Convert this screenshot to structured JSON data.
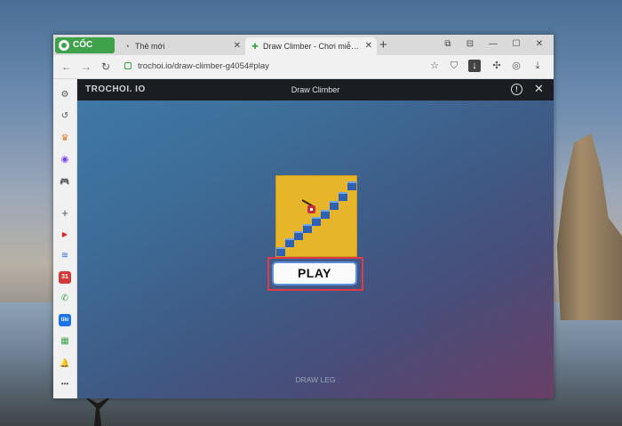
{
  "browser": {
    "brand": "CỐC CỐC",
    "tabs": [
      {
        "label": "Thẻ mới",
        "icon": "coccoc-icon",
        "active": false
      },
      {
        "label": "Draw Climber - Chơi miễn phí",
        "icon": "gamepad-icon",
        "active": true
      }
    ],
    "new_tab": "+",
    "url": "trochoi.io/draw-climber-g4054#play",
    "window_controls": {
      "minimize": "—",
      "maximize": "☐",
      "close": "✕"
    }
  },
  "sidebar": {
    "items": [
      {
        "name": "settings",
        "icon": "gear-icon",
        "glyph": "⚙"
      },
      {
        "name": "history",
        "icon": "history-icon",
        "glyph": "↺"
      },
      {
        "name": "crown",
        "icon": "crown-icon",
        "glyph": "♛"
      },
      {
        "name": "messenger",
        "icon": "messenger-icon",
        "glyph": "◉"
      },
      {
        "name": "games",
        "icon": "gamepad-icon",
        "glyph": "🎮"
      },
      {
        "name": "add",
        "icon": "plus-icon",
        "glyph": "+"
      },
      {
        "name": "youtube",
        "icon": "youtube-icon",
        "glyph": "▶"
      },
      {
        "name": "wifi",
        "icon": "wifi-icon",
        "glyph": "≋"
      },
      {
        "name": "calendar",
        "icon": "calendar-icon",
        "glyph": "31"
      },
      {
        "name": "chat",
        "icon": "chat-icon",
        "glyph": "✆"
      },
      {
        "name": "tiki",
        "icon": "tiki-icon",
        "glyph": "tiki"
      },
      {
        "name": "sheet",
        "icon": "sheet-icon",
        "glyph": "▦"
      },
      {
        "name": "notifications",
        "icon": "bell-icon",
        "glyph": "🔔"
      },
      {
        "name": "more",
        "icon": "more-icon",
        "glyph": "•••"
      }
    ]
  },
  "game": {
    "site_logo": "TROCHOI. IO",
    "title": "Draw Climber",
    "play_label": "PLAY",
    "hint": "DRAW LEG"
  },
  "colors": {
    "brand_green": "#3da24a",
    "highlight_red": "#e0394a",
    "play_border_blue": "#5b8fd8",
    "thumbnail_yellow": "#e7b52a"
  }
}
